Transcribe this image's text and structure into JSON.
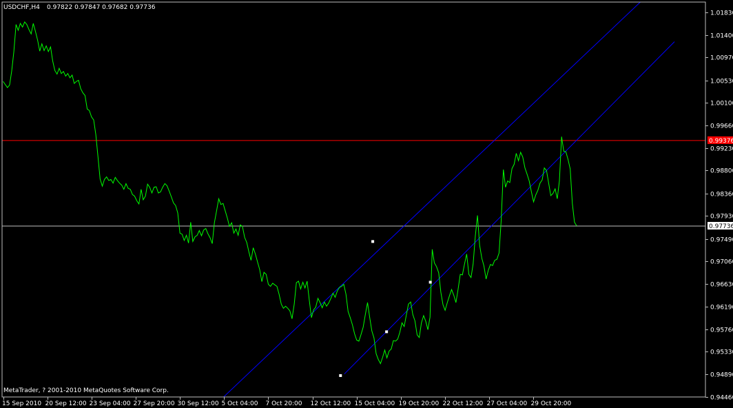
{
  "header": {
    "symbol_label": "USDCHF,H4",
    "ohlc_label": "0.97822 0.97847 0.97682 0.97736"
  },
  "footer": {
    "copyright": "MetaTrader, ? 2001-2010 MetaQuotes Software Corp."
  },
  "colors": {
    "background": "#000000",
    "price_line": "#00ff00",
    "channel": "#0000ff",
    "resistance_line": "#ff0000",
    "current_price_line": "#c0c0c0",
    "axis_frame": "#c0c0c0",
    "label_text": "#ffffff",
    "anchor_point": "#ffffff"
  },
  "chart_data": {
    "type": "line",
    "symbol": "USDCHF",
    "timeframe": "H4",
    "ylim": [
      0.9446,
      1.0203
    ],
    "y_ticks": [
      "1.01830",
      "1.01400",
      "1.00970",
      "1.00530",
      "1.00100",
      "0.99660",
      "0.99230",
      "0.98800",
      "0.98360",
      "0.97930",
      "0.97490",
      "0.97060",
      "0.96630",
      "0.96190",
      "0.95760",
      "0.95330",
      "0.94890",
      "0.94460"
    ],
    "x_ticks": [
      "15 Sep 2010",
      "20 Sep 12:00",
      "23 Sep 04:00",
      "27 Sep 20:00",
      "30 Sep 12:00",
      "5 Oct 04:00",
      "7 Oct 20:00",
      "12 Oct 12:00",
      "15 Oct 04:00",
      "19 Oct 20:00",
      "22 Oct 12:00",
      "27 Oct 04:00",
      "29 Oct 20:00"
    ],
    "series": [
      {
        "values": [
          1.0051,
          1.0045,
          1.0039,
          1.0044,
          1.0071,
          1.0108,
          1.016,
          1.0149,
          1.0162,
          1.0155,
          1.0165,
          1.016,
          1.015,
          1.0142,
          1.0162,
          1.0147,
          1.013,
          1.0109,
          1.0123,
          1.011,
          1.0119,
          1.0108,
          1.0117,
          1.009,
          1.0072,
          1.0065,
          1.0076,
          1.0066,
          1.007,
          1.0061,
          1.0066,
          1.0058,
          1.0063,
          1.0047,
          1.0051,
          1.0053,
          1.0037,
          1.0029,
          1.0024,
          0.9998,
          0.9995,
          0.9983,
          0.9977,
          0.9949,
          0.9907,
          0.9864,
          0.985,
          0.9863,
          0.9868,
          0.9861,
          0.9863,
          0.9856,
          0.9867,
          0.9861,
          0.9856,
          0.9852,
          0.9844,
          0.9855,
          0.9846,
          0.9844,
          0.9834,
          0.9831,
          0.9822,
          0.9816,
          0.9844,
          0.9824,
          0.9831,
          0.9854,
          0.9848,
          0.9837,
          0.9848,
          0.9849,
          0.9837,
          0.9839,
          0.9848,
          0.9855,
          0.9851,
          0.9841,
          0.983,
          0.9818,
          0.9813,
          0.9799,
          0.976,
          0.9758,
          0.9746,
          0.9756,
          0.9741,
          0.9781,
          0.9744,
          0.9753,
          0.9756,
          0.9765,
          0.9755,
          0.9766,
          0.9769,
          0.9759,
          0.9751,
          0.974,
          0.978,
          0.9803,
          0.9826,
          0.9815,
          0.9817,
          0.9803,
          0.9789,
          0.9773,
          0.978,
          0.976,
          0.9768,
          0.9756,
          0.9776,
          0.9773,
          0.9752,
          0.9742,
          0.9724,
          0.9708,
          0.9732,
          0.972,
          0.9705,
          0.969,
          0.9667,
          0.9685,
          0.9681,
          0.9662,
          0.9658,
          0.9664,
          0.9661,
          0.9658,
          0.9643,
          0.9624,
          0.9616,
          0.962,
          0.9616,
          0.9611,
          0.9596,
          0.9624,
          0.9665,
          0.9668,
          0.9653,
          0.9666,
          0.9655,
          0.9668,
          0.9631,
          0.9598,
          0.9613,
          0.9618,
          0.9635,
          0.9627,
          0.9617,
          0.9628,
          0.962,
          0.9626,
          0.9635,
          0.9645,
          0.9637,
          0.9649,
          0.9656,
          0.9658,
          0.9662,
          0.9643,
          0.961,
          0.9598,
          0.9584,
          0.9567,
          0.9555,
          0.9553,
          0.9566,
          0.958,
          0.9604,
          0.9627,
          0.9599,
          0.9573,
          0.9559,
          0.9529,
          0.9518,
          0.951,
          0.9522,
          0.9536,
          0.9521,
          0.9534,
          0.9538,
          0.9554,
          0.9553,
          0.9557,
          0.957,
          0.9588,
          0.9581,
          0.9603,
          0.9624,
          0.9628,
          0.9604,
          0.9592,
          0.9565,
          0.956,
          0.9588,
          0.9602,
          0.9591,
          0.9575,
          0.9599,
          0.9729,
          0.9703,
          0.9696,
          0.9684,
          0.9647,
          0.9623,
          0.9612,
          0.9627,
          0.964,
          0.9652,
          0.9641,
          0.9627,
          0.9652,
          0.9681,
          0.968,
          0.9701,
          0.972,
          0.9681,
          0.9675,
          0.9701,
          0.9755,
          0.9794,
          0.9737,
          0.9712,
          0.9697,
          0.9672,
          0.9689,
          0.97,
          0.9698,
          0.9708,
          0.971,
          0.9722,
          0.9784,
          0.9882,
          0.9848,
          0.986,
          0.9857,
          0.9884,
          0.9892,
          0.9913,
          0.9899,
          0.9915,
          0.9906,
          0.9885,
          0.9873,
          0.986,
          0.9839,
          0.982,
          0.9833,
          0.9842,
          0.9856,
          0.9862,
          0.9885,
          0.988,
          0.9856,
          0.9832,
          0.9836,
          0.9845,
          0.9826,
          0.986,
          0.9945,
          0.9917,
          0.9916,
          0.9901,
          0.9883,
          0.9817,
          0.9781,
          0.9774
        ]
      }
    ],
    "annotations": {
      "horizontal_lines": [
        {
          "price": 0.99376,
          "label": "0.99376"
        },
        {
          "price": 0.97736,
          "label": "0.97736"
        }
      ],
      "channel_lines": [
        {
          "from": {
            "bar": 102.26,
            "price": 0.9446
          },
          "to": {
            "bar": 295.52,
            "price": 1.0203
          }
        },
        {
          "from": {
            "bar": 158.25,
            "price": 0.949
          },
          "to": {
            "bar": 311.37,
            "price": 1.0127
          }
        }
      ],
      "anchor_points": [
        {
          "bar": 171.43,
          "price": 0.9744
        },
        {
          "bar": 177.84,
          "price": 0.9571
        },
        {
          "bar": 198.13,
          "price": 0.9666
        },
        {
          "bar": 156.48,
          "price": 0.9487
        }
      ]
    }
  }
}
